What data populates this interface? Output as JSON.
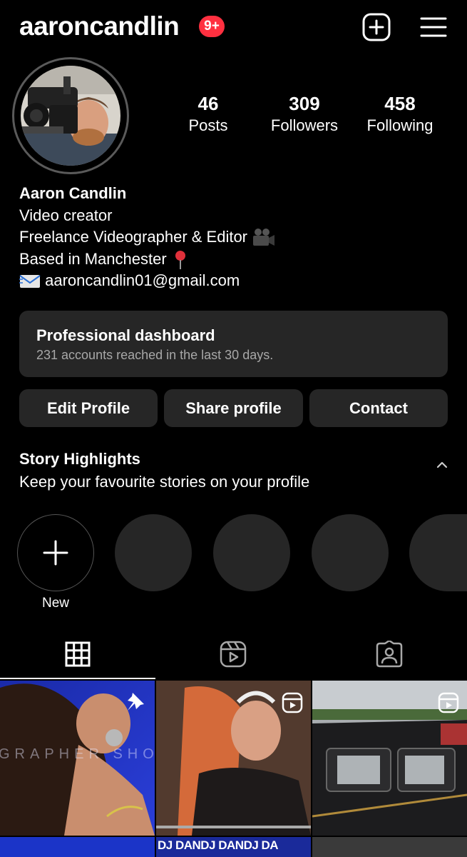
{
  "header": {
    "username": "aaroncandlin",
    "notification_badge": "9+",
    "icons": [
      "add-post-icon",
      "hamburger-menu-icon"
    ]
  },
  "stats": {
    "posts": {
      "value": "46",
      "label": "Posts"
    },
    "followers": {
      "value": "309",
      "label": "Followers"
    },
    "following": {
      "value": "458",
      "label": "Following"
    }
  },
  "bio": {
    "name": "Aaron Candlin",
    "line1": "Video creator",
    "line2": "Freelance Videographer & Editor",
    "line3": "Based in Manchester",
    "email": "aaroncandlin01@gmail.com"
  },
  "dashboard": {
    "title": "Professional dashboard",
    "subtitle": "231 accounts reached in the last 30 days."
  },
  "buttons": {
    "edit": "Edit Profile",
    "share": "Share profile",
    "contact": "Contact"
  },
  "highlights": {
    "title": "Story Highlights",
    "subtitle": "Keep your favourite stories on your profile",
    "new_label": "New"
  },
  "tabs": [
    "grid-icon",
    "reels-icon",
    "tagged-icon"
  ],
  "posts": {
    "post1_overlay_text": "GRAPHER SHO",
    "post4_overlay_text": "DJ DANDJ DANDJ DA"
  },
  "colors": {
    "background": "#000000",
    "card": "#262626",
    "badge": "#ff3040",
    "muted_text": "#a8a8a8"
  }
}
